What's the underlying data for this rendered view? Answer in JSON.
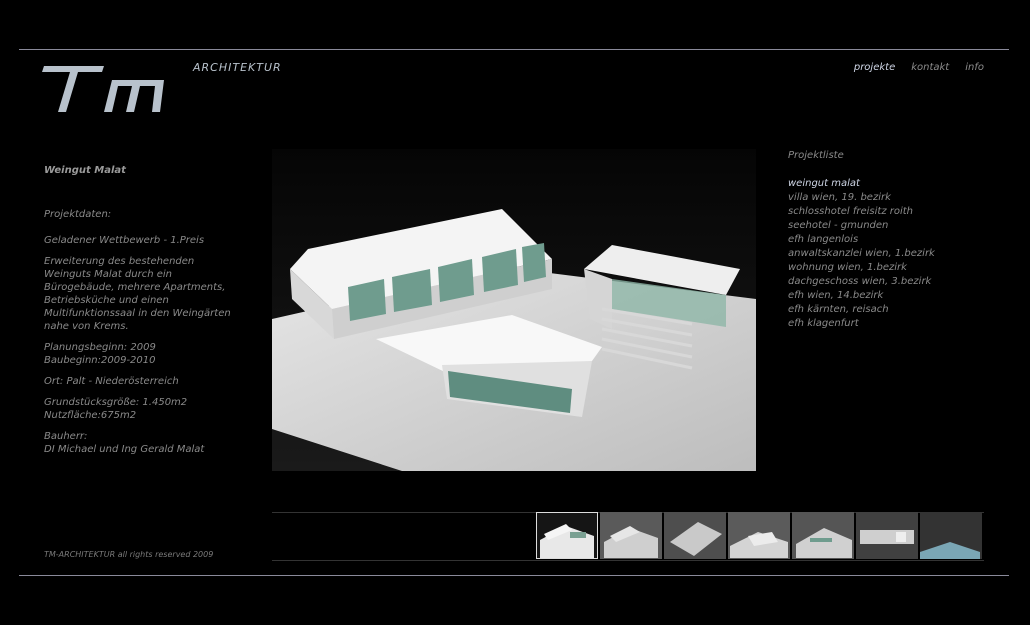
{
  "brand": {
    "logo_icon": "tm-logo-icon",
    "subtitle": "ARCHITEKTUR"
  },
  "nav": {
    "items": [
      {
        "label": "projekte",
        "active": true
      },
      {
        "label": "kontakt",
        "active": false
      },
      {
        "label": "info",
        "active": false
      }
    ]
  },
  "project": {
    "title": "Weingut Malat",
    "data_label": "Projektdaten:",
    "competition": "Geladener Wettbewerb - 1.Preis",
    "description": "Erweiterung des bestehenden Weinguts Malat durch ein Bürogebäude, mehrere Apartments, Betriebsküche und einen Multifunktionssaal in den Weingärten nahe von Krems.",
    "planning": "Planungsbeginn: 2009",
    "construction": "Baubeginn:2009-2010",
    "location": "Ort: Palt - Niederösterreich",
    "plot_size": "Grundstücksgröße: 1.450m2",
    "usable_area": "Nutzfläche:675m2",
    "client_label": "Bauherr:",
    "client": "DI Michael und Ing Gerald Malat"
  },
  "footer": {
    "copyright": "TM-ARCHITEKTUR all rights reserved 2009"
  },
  "project_list": {
    "heading": "Projektliste",
    "items": [
      {
        "label": "weingut malat",
        "active": true
      },
      {
        "label": "villa wien, 19. bezirk",
        "active": false
      },
      {
        "label": "schlosshotel freisitz roith",
        "active": false
      },
      {
        "label": "seehotel - gmunden",
        "active": false
      },
      {
        "label": "efh langenlois",
        "active": false
      },
      {
        "label": "anwaltskanzlei wien, 1.bezirk",
        "active": false
      },
      {
        "label": "wohnung wien, 1.bezirk",
        "active": false
      },
      {
        "label": "dachgeschoss wien, 3.bezirk",
        "active": false
      },
      {
        "label": "efh wien, 14.bezirk",
        "active": false
      },
      {
        "label": "efh kärnten, reisach",
        "active": false
      },
      {
        "label": "efh klagenfurt",
        "active": false
      }
    ]
  },
  "gallery": {
    "main_image": "architecture-model-photo",
    "thumbnail_count": 7,
    "active_index": 0
  }
}
